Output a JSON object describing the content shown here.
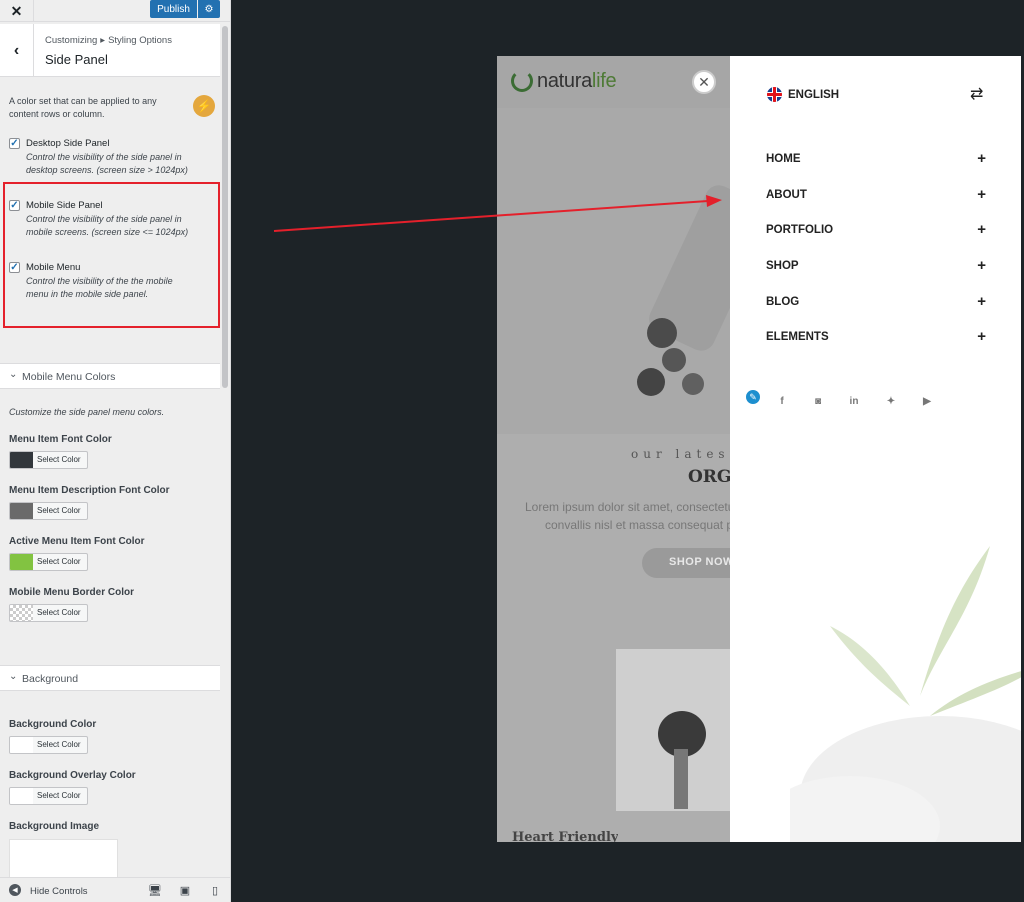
{
  "topbar": {
    "close_glyph": "✕",
    "publish_label": "Publish",
    "settings_icon": "gear-icon"
  },
  "section_header": {
    "back_glyph": "‹",
    "breadcrumb_root": "Customizing",
    "breadcrumb_sep": "▸",
    "breadcrumb_section": "Styling Options",
    "title": "Side Panel"
  },
  "intro": {
    "line1": "A color set that can be applied to any",
    "line2": "content rows or column."
  },
  "options": [
    {
      "label": "Desktop Side Panel",
      "desc1": "Control the visibility of the side panel in",
      "desc2": "desktop screens. (screen size > 1024px)",
      "checked": true
    },
    {
      "label": "Mobile Side Panel",
      "desc1": "Control the visibility of the side panel in",
      "desc2": "mobile screens. (screen size <= 1024px)",
      "checked": true
    },
    {
      "label": "Mobile Menu",
      "desc1": "Control the visibility of the the mobile",
      "desc2": "menu in the mobile side panel.",
      "checked": true
    }
  ],
  "mobile_menu_colors": {
    "heading": "Mobile Menu Colors",
    "description": "Customize the side panel menu colors.",
    "fields": [
      {
        "label": "Menu Item Font Color",
        "button": "Select Color",
        "color": "#32373c"
      },
      {
        "label": "Menu Item Description Font Color",
        "button": "Select Color",
        "color": "#6a6a6a"
      },
      {
        "label": "Active Menu Item Font Color",
        "button": "Select Color",
        "color": "#82c341"
      },
      {
        "label": "Mobile Menu Border Color",
        "button": "Select Color",
        "color": "transparent"
      }
    ]
  },
  "background": {
    "heading": "Background",
    "fields": [
      {
        "label": "Background Color",
        "button": "Select Color",
        "color": "#ffffff"
      },
      {
        "label": "Background Overlay Color",
        "button": "Select Color",
        "color": "#ffffff"
      }
    ],
    "image_label": "Background Image"
  },
  "footer": {
    "hide_label": "Hide Controls",
    "devices": [
      "desktop-icon",
      "tablet-icon",
      "mobile-icon"
    ]
  },
  "preview": {
    "logo_part1": "natura",
    "logo_part2": "life",
    "tagline": "our latest s",
    "heading": "ORGA",
    "lorem1": "Lorem ipsum dolor sit amet, consectetu",
    "lorem2": "convallis nisl et massa consequat p",
    "shop_label": "SHOP NOW",
    "bottom_heading": "Heart Friendly"
  },
  "side_panel": {
    "language": "ENGLISH",
    "menu": [
      {
        "label": "HOME",
        "expand": "+"
      },
      {
        "label": "ABOUT",
        "expand": "+"
      },
      {
        "label": "PORTFOLIO",
        "expand": "+"
      },
      {
        "label": "SHOP",
        "expand": "+"
      },
      {
        "label": "BLOG",
        "expand": "+"
      },
      {
        "label": "ELEMENTS",
        "expand": "+"
      }
    ],
    "socials": [
      "facebook-icon",
      "instagram-icon",
      "linkedin-icon",
      "twitter-icon",
      "youtube-icon"
    ],
    "social_glyphs": [
      "f",
      "◙",
      "in",
      "✦",
      "▶"
    ]
  },
  "colors": {
    "accent": "#2271b1",
    "highlight": "#e4202b",
    "brand_green": "#5aa132"
  }
}
